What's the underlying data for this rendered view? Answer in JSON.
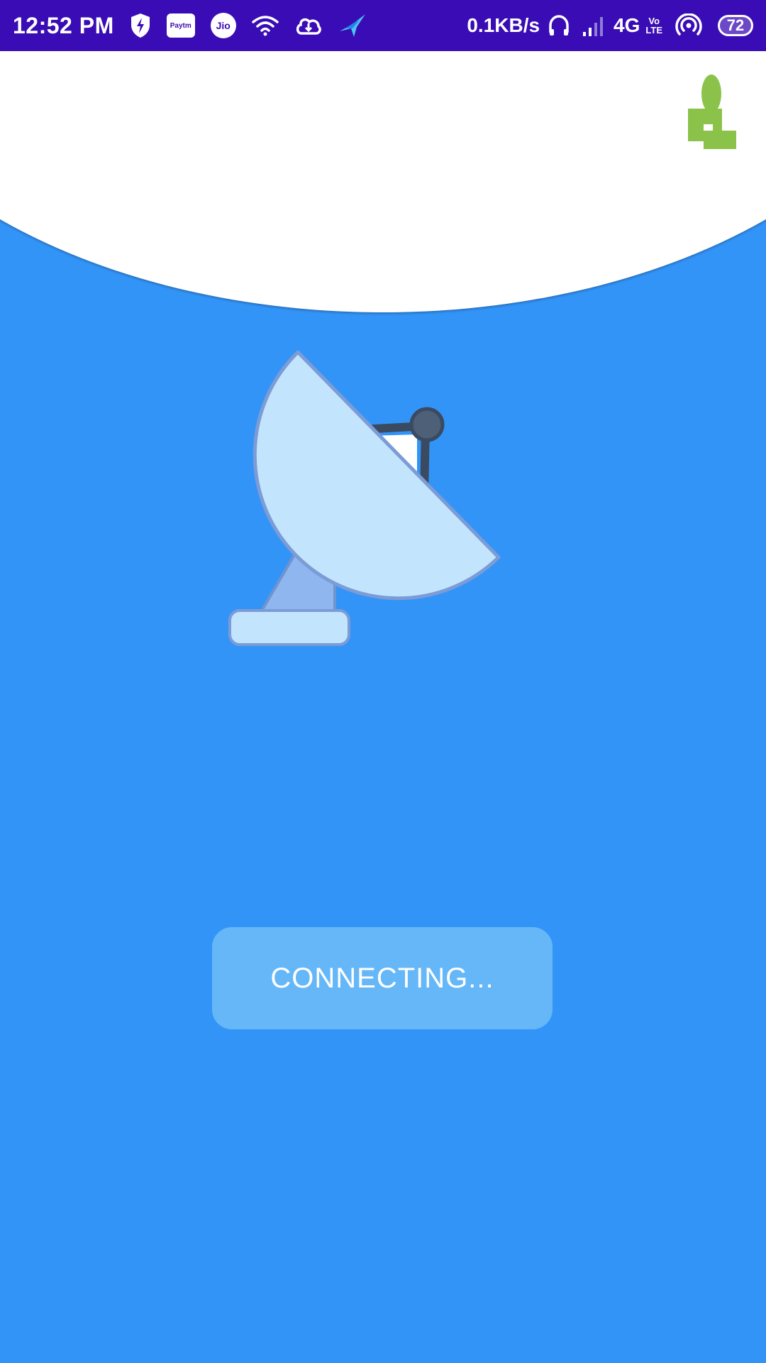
{
  "status_bar": {
    "time": "12:52 PM",
    "paytm_label": "Paytm",
    "jio_label": "Jio",
    "net_speed": "0.1KB/s",
    "network_type": "4G",
    "volte_top": "Vo",
    "volte_bottom": "LTE",
    "battery": "72",
    "icons": [
      "shield-bolt-icon",
      "paytm-icon",
      "jio-icon",
      "wifi-icon",
      "cloud-icon",
      "bird-icon",
      "headphones-icon",
      "signal-icon",
      "hotspot-icon",
      "battery-icon"
    ]
  },
  "header": {
    "logo_icon": "green-logo-icon",
    "logo_color": "#8bc34a"
  },
  "main": {
    "illustration": "satellite-dish-icon",
    "button_label": "CONNECTING..."
  },
  "colors": {
    "status_bar": "#3a0cb5",
    "background": "#3394f8",
    "button": "#66b7f8",
    "header": "#ffffff"
  }
}
